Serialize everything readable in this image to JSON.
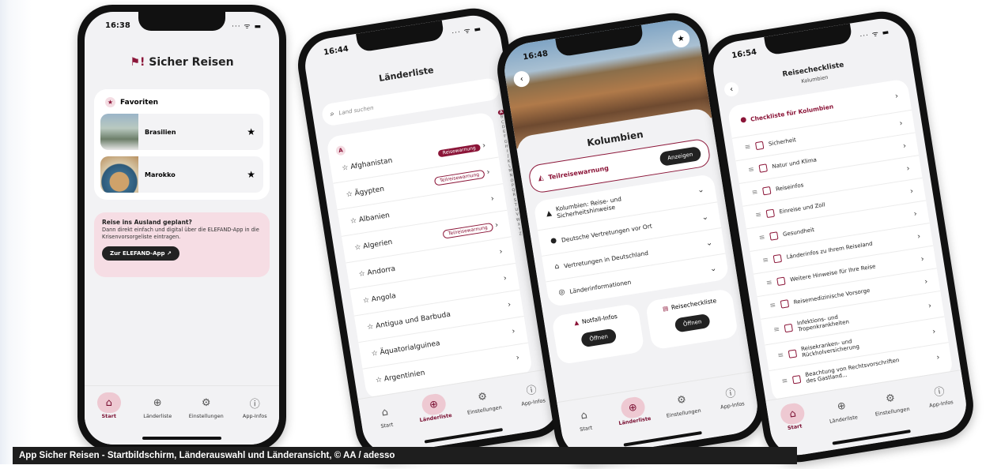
{
  "caption": "App Sicher Reisen - Startbildschirm, Länderauswahl und Länderansicht, © AA / adesso",
  "phone1": {
    "time": "16:38",
    "app_title": "Sicher Reisen",
    "favorites_title": "Favoriten",
    "favorites": [
      {
        "name": "Brasilien"
      },
      {
        "name": "Marokko"
      }
    ],
    "promo_title": "Reise ins Ausland geplant?",
    "promo_text": "Dann direkt einfach und digital über die ELEFAND-App in die Krisenvorsorgeliste eintragen.",
    "promo_button": "Zur ELEFAND-App ↗"
  },
  "phone2": {
    "time": "16:44",
    "title": "Länderliste",
    "search_placeholder": "Land suchen",
    "section_letter": "A",
    "countries": [
      {
        "name": "Afghanistan",
        "badge": "Reisewarnung",
        "badge_type": "fill"
      },
      {
        "name": "Ägypten",
        "badge": "Teilreisewarnung",
        "badge_type": "outline"
      },
      {
        "name": "Albanien",
        "badge": "",
        "badge_type": ""
      },
      {
        "name": "Algerien",
        "badge": "Teilreisewarnung",
        "badge_type": "outline"
      },
      {
        "name": "Andorra",
        "badge": "",
        "badge_type": ""
      },
      {
        "name": "Angola",
        "badge": "",
        "badge_type": ""
      },
      {
        "name": "Antigua und Barbuda",
        "badge": "",
        "badge_type": ""
      },
      {
        "name": "Äquatorialguinea",
        "badge": "",
        "badge_type": ""
      },
      {
        "name": "Argentinien",
        "badge": "",
        "badge_type": ""
      }
    ],
    "alphabet": [
      "A",
      "B",
      "C",
      "D",
      "E",
      "F",
      "G",
      "H",
      "I",
      "J",
      "K",
      "L",
      "M",
      "N",
      "O",
      "P",
      "Q",
      "R",
      "S",
      "T",
      "U",
      "V",
      "W",
      "X",
      "Y",
      "Z"
    ]
  },
  "phone3": {
    "time": "16:48",
    "country": "Kolumbien",
    "warning_label": "Teilreisewarnung",
    "warning_button": "Anzeigen",
    "sections": [
      {
        "label": "Kolumbien: Reise- und Sicherheitshinweise",
        "icon": "warning-icon"
      },
      {
        "label": "Deutsche Vertretungen vor Ort",
        "icon": "location-icon"
      },
      {
        "label": "Vertretungen in Deutschland",
        "icon": "house-icon"
      },
      {
        "label": "Länderinformationen",
        "icon": "globe-icon"
      }
    ],
    "notfall_label": "Notfall-Infos",
    "notfall_button": "Öffnen",
    "checkliste_label": "Reisecheckliste",
    "checkliste_button": "Öffnen"
  },
  "phone4": {
    "time": "16:54",
    "title": "Reisecheckliste",
    "subtitle": "Kolumbien",
    "header_item": "Checkliste für Kolumbien",
    "items": [
      "Sicherheit",
      "Natur und Klima",
      "Reiseinfos",
      "Einreise und Zoll",
      "Gesundheit",
      "Länderinfos zu Ihrem Reiseland",
      "Weitere Hinweise für Ihre Reise",
      "Reisemedizinische Vorsorge",
      "Infektions- und Tropenkrankheiten",
      "Reisekranken- und Rückholversicherung",
      "Beachtung von Rechtsvorschriften des Gastland..."
    ]
  },
  "tabs": [
    {
      "label": "Start",
      "icon": "home-icon"
    },
    {
      "label": "Länderliste",
      "icon": "globe-search-icon"
    },
    {
      "label": "Einstellungen",
      "icon": "gear-icon"
    },
    {
      "label": "App-Infos",
      "icon": "info-icon"
    }
  ],
  "colors": {
    "accent": "#8b1538",
    "accent_light": "#eec9d2"
  }
}
